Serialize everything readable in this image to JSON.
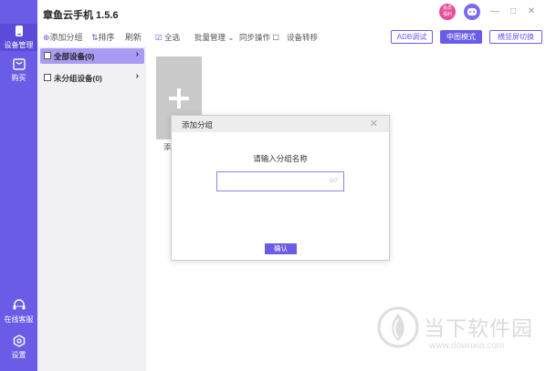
{
  "app": {
    "title": "章鱼云手机 1.5.6",
    "badge_text_top": "会员",
    "badge_text_bottom": "福利"
  },
  "rail": {
    "items": [
      {
        "label": "设备管理",
        "icon": "phone-device-icon"
      },
      {
        "label": "购买",
        "icon": "shop-icon"
      },
      {
        "label": "在线客服",
        "icon": "headset-icon"
      },
      {
        "label": "设置",
        "icon": "gear-icon"
      }
    ]
  },
  "window_controls": {
    "minimize": "—",
    "maximize": "□",
    "close": "✕"
  },
  "toolbar_left": {
    "add_group": "添加分组",
    "sort": "排序",
    "refresh": "刷新"
  },
  "groups": [
    {
      "label": "全部设备(0)",
      "active": true
    },
    {
      "label": "未分组设备(0)",
      "active": false
    }
  ],
  "toolbar_right": {
    "select_all": "全选",
    "batch_manage": "批量管理",
    "sync_ops": "同步操作",
    "transfer_device": "设备转移",
    "adb_debug": "ADB调试",
    "medium_view": "中图模式",
    "orientation_switch": "横竖屏切换"
  },
  "content": {
    "add_card_label": "添"
  },
  "dialog": {
    "title": "添加分组",
    "prompt": "请输入分组名称",
    "input_value": "",
    "input_counter": "0/7",
    "confirm": "确认",
    "close": "✕"
  },
  "watermark": {
    "text": "当下软件园",
    "url": "www.downxia.com"
  },
  "colors": {
    "accent": "#6b5ce7",
    "rail_bg": "#6b5ce7",
    "group_active_bg": "#a99bf3",
    "panel_bg": "#f1f1f4"
  }
}
